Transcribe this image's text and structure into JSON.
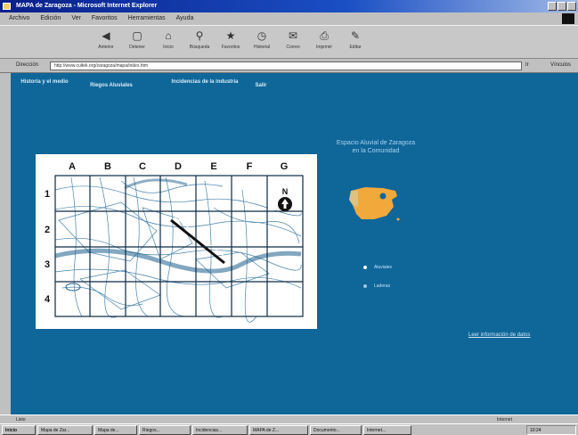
{
  "window": {
    "title": "MAPA de Zaragoza - Microsoft Internet Explorer"
  },
  "menu": [
    "Archivo",
    "Edición",
    "Ver",
    "Favoritos",
    "Herramientas",
    "Ayuda"
  ],
  "toolbar": [
    {
      "icon": "back-icon",
      "label": "Anterior"
    },
    {
      "icon": "stop-icon",
      "label": "Detener"
    },
    {
      "icon": "home-icon",
      "label": "Inicio"
    },
    {
      "icon": "search-icon",
      "label": "Búsqueda"
    },
    {
      "icon": "favorites-icon",
      "label": "Favoritos"
    },
    {
      "icon": "history-icon",
      "label": "Historial"
    },
    {
      "icon": "mail-icon",
      "label": "Correo"
    },
    {
      "icon": "print-icon",
      "label": "Imprimir"
    },
    {
      "icon": "edit-icon",
      "label": "Editar"
    }
  ],
  "address": {
    "label": "Dirección",
    "url": "http://www.cultek.org/zaragoza/mapa/index.htm",
    "go": "Ir",
    "links": "Vínculos"
  },
  "nav": [
    "Historia y el medio",
    "Riegos Aluviales",
    "Incidencias de la industria",
    "Salir"
  ],
  "map": {
    "columns": [
      "A",
      "B",
      "C",
      "D",
      "E",
      "F",
      "G"
    ],
    "rows": [
      "1",
      "2",
      "3",
      "4"
    ],
    "north": "N"
  },
  "caption": "Espacio Aluvial de Zaragoza en la Comunidad",
  "legend": [
    {
      "label": "Aluviales",
      "color": "#ffffff"
    },
    {
      "label": "Laderas",
      "color": "#9cc6e4"
    }
  ],
  "more_link": "Leer información de datos",
  "status": {
    "text": "Listo",
    "zone": "Internet"
  },
  "taskbar": {
    "start": "Inicio",
    "items": [
      "Mapa de Zar...",
      "Mapa de...",
      "Riegos...",
      "Incidencias...",
      "MAPA de Z...",
      "Documento...",
      "Internet..."
    ],
    "clock": "10:24"
  }
}
